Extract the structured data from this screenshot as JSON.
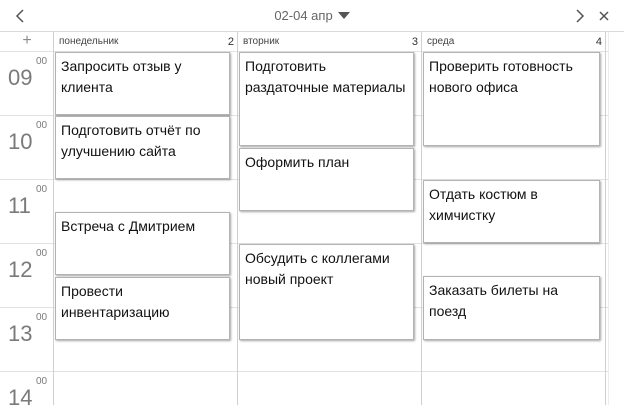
{
  "header": {
    "prev_icon": "chevron-left-icon",
    "range_label": "02-04 апр",
    "next_icon": "chevron-right-icon",
    "close_icon": "close-icon"
  },
  "add_label": "+",
  "days": [
    {
      "name": "понедельник",
      "num": "2"
    },
    {
      "name": "вторник",
      "num": "3"
    },
    {
      "name": "среда",
      "num": "4"
    }
  ],
  "hours": [
    {
      "h": "09",
      "m": "00"
    },
    {
      "h": "10",
      "m": "00"
    },
    {
      "h": "11",
      "m": "00"
    },
    {
      "h": "12",
      "m": "00"
    },
    {
      "h": "13",
      "m": "00"
    },
    {
      "h": "14",
      "m": "00"
    }
  ],
  "events": {
    "monday": [
      "Запросить отзыв у клиента",
      "Подготовить отчёт по улучшению сайта",
      "Встреча с Дмитрием",
      "Провести инвентаризацию"
    ],
    "tuesday": [
      "Подготовить раздаточные материалы",
      "Оформить план",
      "Обсудить с коллегами новый проект"
    ],
    "wednesday": [
      "Проверить готовность нового офиса",
      "Отдать костюм в химчистку",
      "Заказать билеты на поезд"
    ]
  }
}
